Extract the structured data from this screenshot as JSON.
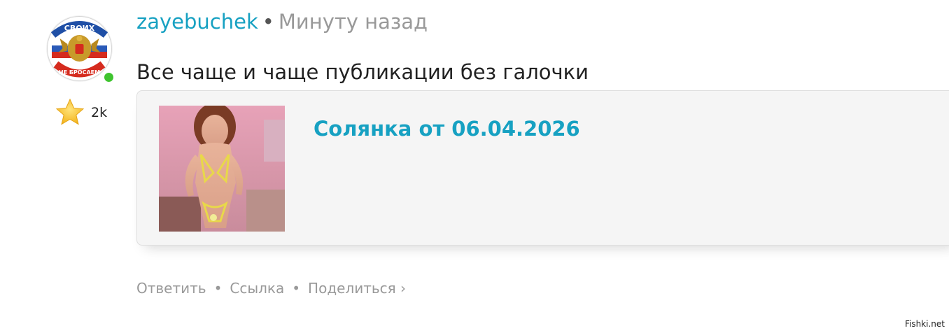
{
  "avatar": {
    "badge_top": "СВОИХ",
    "badge_bottom": "НЕ БРОСАЕМ",
    "online": true
  },
  "rating": {
    "icon": "star-icon",
    "value": "2k"
  },
  "post": {
    "username": "zayebuchek",
    "separator": "•",
    "time": "Минуту назад",
    "text": "Все чаще и чаще публикации без галочки"
  },
  "card": {
    "title": "Солянка от 06.04.2026"
  },
  "actions": {
    "reply": "Ответить",
    "sep": "•",
    "link": "Ссылка",
    "share": "Поделиться ›"
  },
  "watermark": "Fishki.net",
  "colors": {
    "accent": "#17a1c2",
    "muted": "#999999",
    "online": "#3fc42f"
  }
}
